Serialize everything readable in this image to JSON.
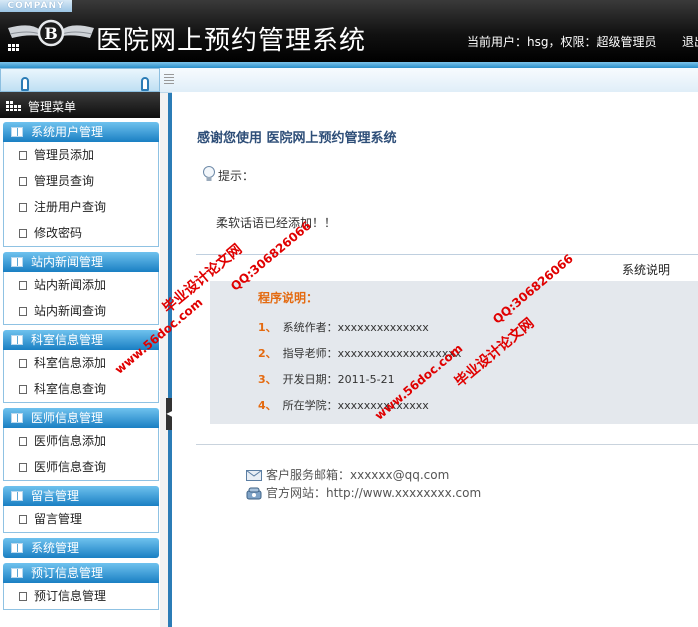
{
  "header": {
    "company_badge": "COMPANY",
    "logo_letter": "B",
    "app_title": "医院网上预约管理系统",
    "user_info": "当前用户：hsg，权限：超级管理员",
    "logout_label": "退出"
  },
  "sidebar": {
    "title": "管理菜单",
    "groups": [
      {
        "title": "系统用户管理",
        "items": [
          "管理员添加",
          "管理员查询",
          "注册用户查询",
          "修改密码"
        ]
      },
      {
        "title": "站内新闻管理",
        "items": [
          "站内新闻添加",
          "站内新闻查询"
        ]
      },
      {
        "title": "科室信息管理",
        "items": [
          "科室信息添加",
          "科室信息查询"
        ]
      },
      {
        "title": "医师信息管理",
        "items": [
          "医师信息添加",
          "医师信息查询"
        ]
      },
      {
        "title": "留言管理",
        "items": [
          "留言管理"
        ]
      },
      {
        "title": "系统管理",
        "items": []
      },
      {
        "title": "预订信息管理",
        "items": [
          "预订信息管理"
        ]
      }
    ]
  },
  "main": {
    "welcome": "感谢您使用 医院网上预约管理系统",
    "tip_label": "提示：",
    "tip_text": "柔软话语已经添加！！",
    "system_info_label": "系统说明",
    "program": {
      "title": "程序说明：",
      "lines": [
        {
          "num": "1、",
          "label": "系统作者：",
          "value": "xxxxxxxxxxxxxx"
        },
        {
          "num": "2、",
          "label": "指导老师：",
          "value": "xxxxxxxxxxxxxxxxxxx"
        },
        {
          "num": "3、",
          "label": "开发日期：",
          "value": "2011-5-21"
        },
        {
          "num": "4、",
          "label": "所在学院：",
          "value": "xxxxxxxxxxxxxx"
        }
      ]
    },
    "footer": {
      "email": "客户服务邮箱：xxxxxx@qq.com",
      "website": "官方网站：http://www.xxxxxxxx.com"
    }
  },
  "watermarks": [
    {
      "text": "毕业设计论文网"
    },
    {
      "text": "QQ:306826066"
    },
    {
      "text": "www.56doc.com"
    },
    {
      "text": "www.56doc.com"
    },
    {
      "text": "QQ:306826066"
    },
    {
      "text": "毕业设计论文网"
    }
  ],
  "colors": {
    "header_bg": "#111111",
    "accent_blue": "#1a7fc3",
    "title_blue": "#2e4e78",
    "orange": "#e46a10",
    "watermark_red": "#e00000"
  },
  "icons": [
    "book-icon",
    "page-icon",
    "bulb-icon",
    "mail-icon",
    "phone-icon"
  ]
}
